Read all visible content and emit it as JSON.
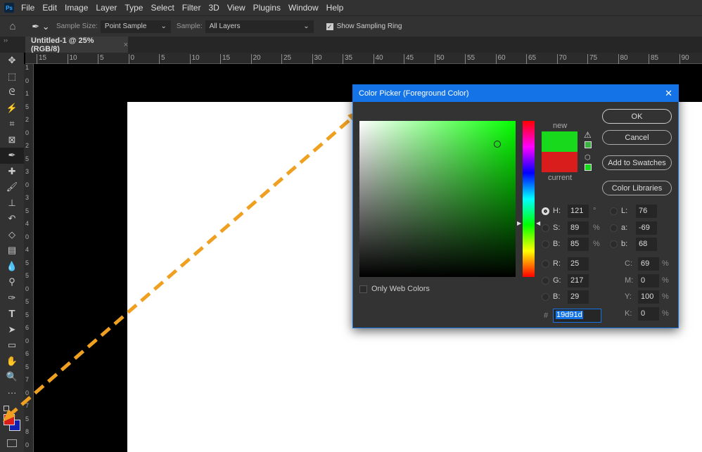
{
  "menubar": {
    "logo": "Ps",
    "items": [
      "File",
      "Edit",
      "Image",
      "Layer",
      "Type",
      "Select",
      "Filter",
      "3D",
      "View",
      "Plugins",
      "Window",
      "Help"
    ]
  },
  "options": {
    "sample_size_label": "Sample Size:",
    "sample_size_value": "Point Sample",
    "sample_label": "Sample:",
    "sample_value": "All Layers",
    "show_ring_label": "Show Sampling Ring",
    "show_ring_checked": true
  },
  "document_tab": {
    "title": "Untitled-1 @ 25% (RGB/8)",
    "close": "×"
  },
  "ruler_top": [
    "15",
    "10",
    "5",
    "0",
    "5",
    "10",
    "15",
    "20",
    "25",
    "30",
    "35",
    "40",
    "45",
    "50",
    "55",
    "60",
    "65",
    "70",
    "75",
    "80",
    "85",
    "90"
  ],
  "ruler_left": [
    "1",
    "0",
    "1",
    "5",
    "2",
    "0",
    "2",
    "5",
    "3",
    "0",
    "3",
    "5",
    "4",
    "0",
    "4",
    "5",
    "5",
    "0",
    "5",
    "5",
    "6",
    "0",
    "6",
    "5",
    "7",
    "0",
    "7",
    "5",
    "8",
    "0"
  ],
  "colors": {
    "foreground": "#d91c1c",
    "background": "#1020b0",
    "new_color": "#19d91d",
    "current_color": "#d91c1c",
    "accent": "#1473e6",
    "arrow": "#f5a623"
  },
  "dialog": {
    "title": "Color Picker (Foreground Color)",
    "close": "✕",
    "new_label": "new",
    "current_label": "current",
    "buttons": {
      "ok": "OK",
      "cancel": "Cancel",
      "add_swatches": "Add to Swatches",
      "color_libraries": "Color Libraries"
    },
    "only_web_colors": "Only Web Colors",
    "hsb": [
      {
        "label": "H:",
        "value": "121",
        "unit": "°",
        "selected": true
      },
      {
        "label": "S:",
        "value": "89",
        "unit": "%"
      },
      {
        "label": "B:",
        "value": "85",
        "unit": "%"
      }
    ],
    "rgb": [
      {
        "label": "R:",
        "value": "25"
      },
      {
        "label": "G:",
        "value": "217"
      },
      {
        "label": "B:",
        "value": "29"
      }
    ],
    "lab": [
      {
        "label": "L:",
        "value": "76"
      },
      {
        "label": "a:",
        "value": "-69"
      },
      {
        "label": "b:",
        "value": "68"
      }
    ],
    "cmyk": [
      {
        "label": "C:",
        "value": "69",
        "unit": "%"
      },
      {
        "label": "M:",
        "value": "0",
        "unit": "%"
      },
      {
        "label": "Y:",
        "value": "100",
        "unit": "%"
      },
      {
        "label": "K:",
        "value": "0",
        "unit": "%"
      }
    ],
    "hex_label": "#",
    "hex": "19d91d"
  }
}
